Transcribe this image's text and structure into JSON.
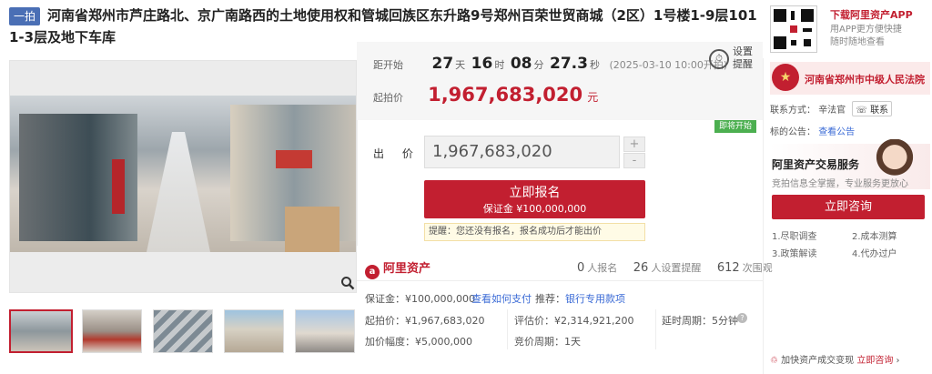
{
  "header": {
    "tag": "一拍",
    "title_line1": "河南省郑州市芦庄路北、京广南路西的土地使用权和管城回族区东升路9号郑州百荣世贸商城（2区）1号楼1-9层101及地下车库",
    "title_line2": "1-3层"
  },
  "countdown": {
    "label": "距开始",
    "days": "27",
    "days_unit": "天",
    "hours": "16",
    "hours_unit": "时",
    "minutes": "08",
    "minutes_unit": "分",
    "seconds": "27.3",
    "seconds_unit": "秒",
    "start_date": "(2025-03-10 10:00开拍)",
    "remind_label": "设置提醒"
  },
  "start_price": {
    "label": "起拍价",
    "value": "1,967,683,020",
    "unit": "元"
  },
  "bid": {
    "badge": "即将开始",
    "label": "出 价",
    "value": "1,967,683,020",
    "plus": "+",
    "minus": "-",
    "apply_main": "立即报名",
    "apply_sub": "保证金 ¥100,000,000",
    "notice": "提醒：您还没有报名，报名成功后才能出价"
  },
  "stats": {
    "brand": "阿里资产",
    "applicants": "0",
    "applicants_label": "人报名",
    "reminders": "26",
    "reminders_label": "人设置提醒",
    "views": "612",
    "views_label": "次围观"
  },
  "details": {
    "deposit": "保证金：¥100,000,000",
    "how_to_pay": "查看如何支付",
    "recommend": "推荐：",
    "bank_link": "银行专用款项",
    "start_price": "起拍价：¥1,967,683,020",
    "appraisal": "评估价：¥2,314,921,200",
    "extension": "延时周期：5分钟",
    "increment": "加价幅度：¥5,000,000",
    "cycle": "竞价周期：1天"
  },
  "app": {
    "title": "下载阿里资产APP",
    "sub1": "用APP更方便快捷",
    "sub2": "随时随地查看"
  },
  "court": {
    "name": "河南省郑州市中级人民法院",
    "contact_label": "联系方式：",
    "contact_name": "辛法官",
    "contact_btn": "联系",
    "notice_label": "标的公告：",
    "notice_link": "查看公告"
  },
  "service": {
    "title": "阿里资产交易服务",
    "sub": "竞拍信息全掌握，专业服务更放心",
    "consult": "立即咨询",
    "items": [
      "1.尽职调查",
      "2.成本测算",
      "3.政策解读",
      "4.代办过户"
    ],
    "footer": "加快资产成交变现",
    "footer_link": "立即咨询"
  },
  "colors": {
    "accent": "#c21f30",
    "link": "#3b6bd6",
    "tag": "#4a6fb5",
    "badge": "#4caf50"
  }
}
